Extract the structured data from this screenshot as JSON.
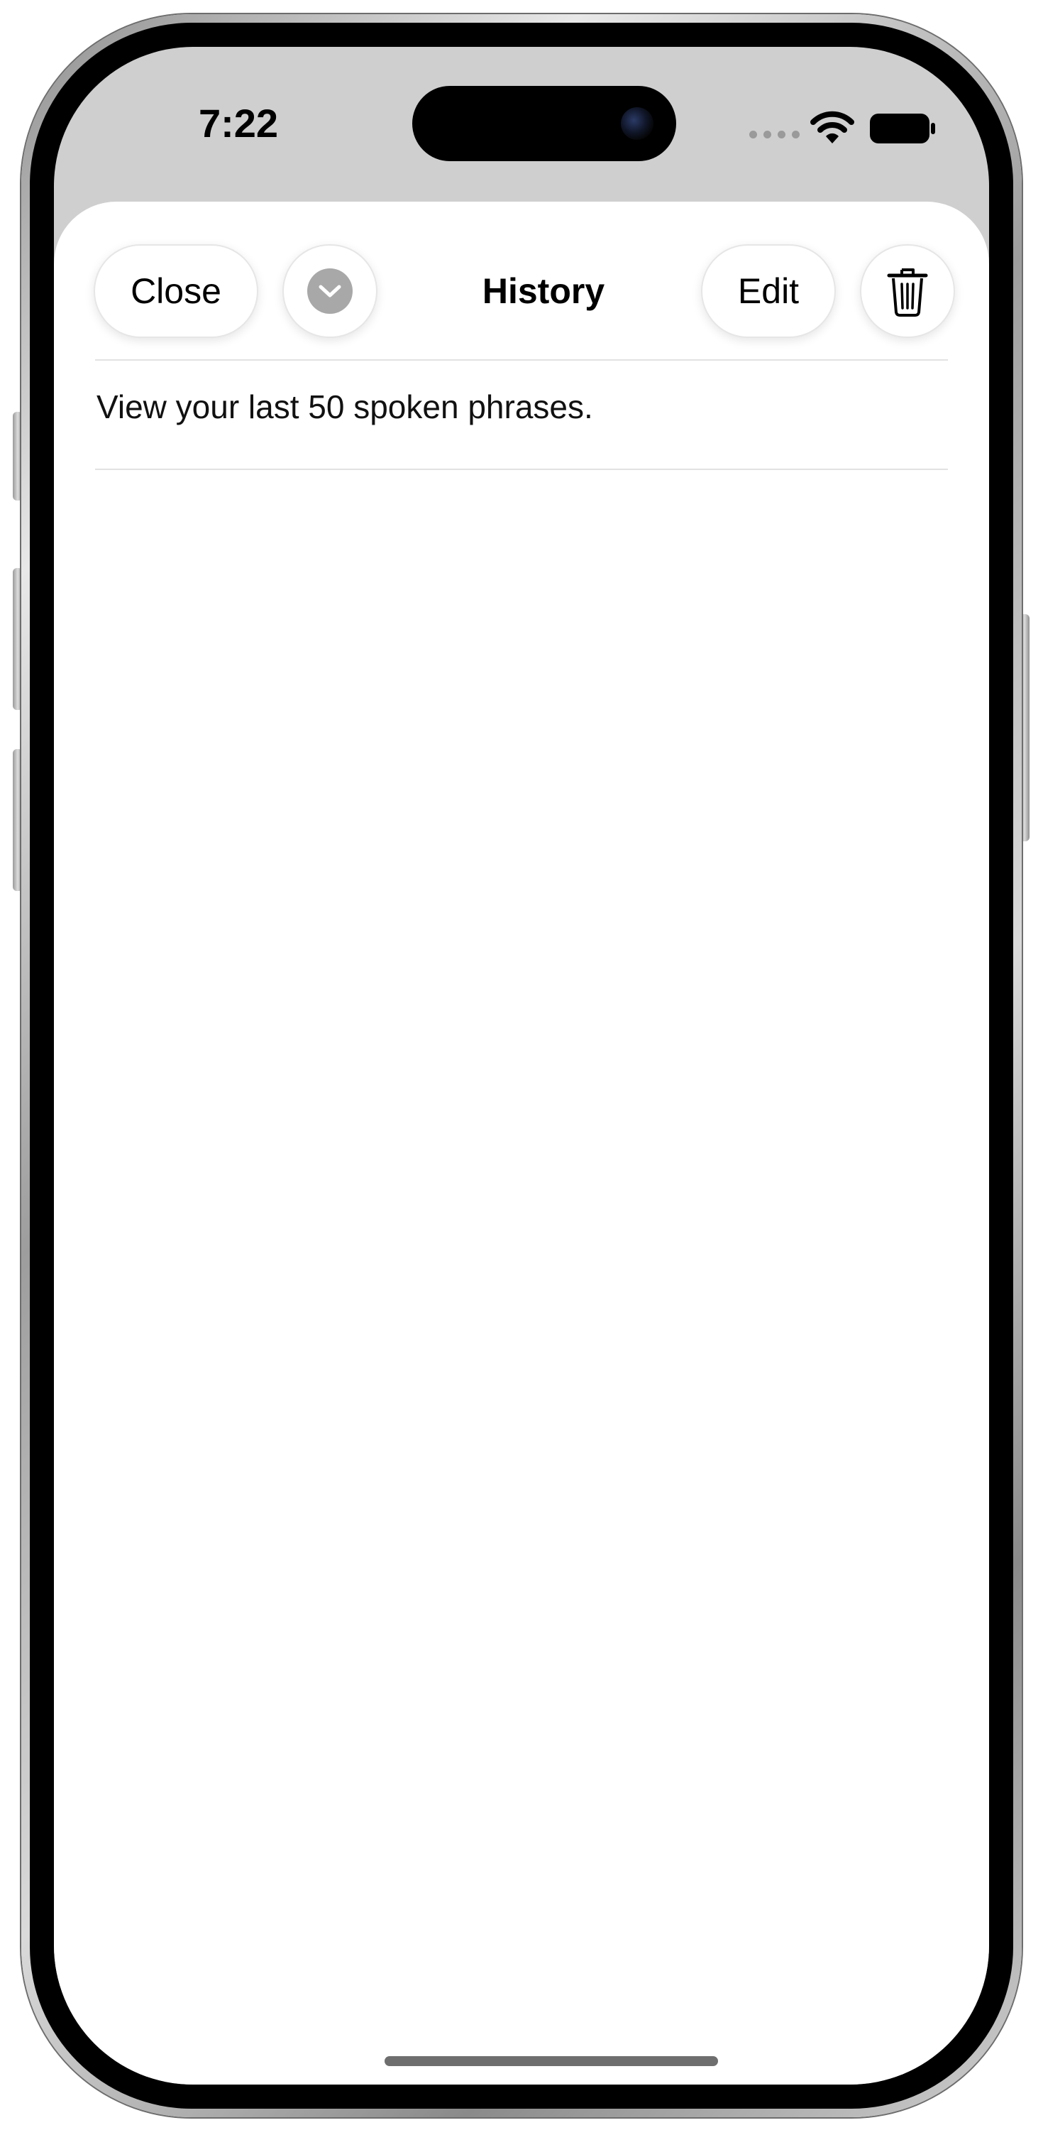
{
  "status_bar": {
    "time": "7:22"
  },
  "header": {
    "close_label": "Close",
    "title": "History",
    "edit_label": "Edit"
  },
  "main": {
    "subtitle": "View your last 50 spoken phrases.",
    "history_items": []
  },
  "icons": {
    "collapse": "chevron-down-icon",
    "delete": "trash-icon",
    "wifi": "wifi-icon",
    "battery": "battery-icon",
    "signal": "cellular-signal-icon"
  },
  "colors": {
    "sheet_background": "#ffffff",
    "backdrop": "#cfcfcf",
    "chevron_fill": "#a8a8a8",
    "divider": "#e2e2e2",
    "text": "#000000"
  }
}
